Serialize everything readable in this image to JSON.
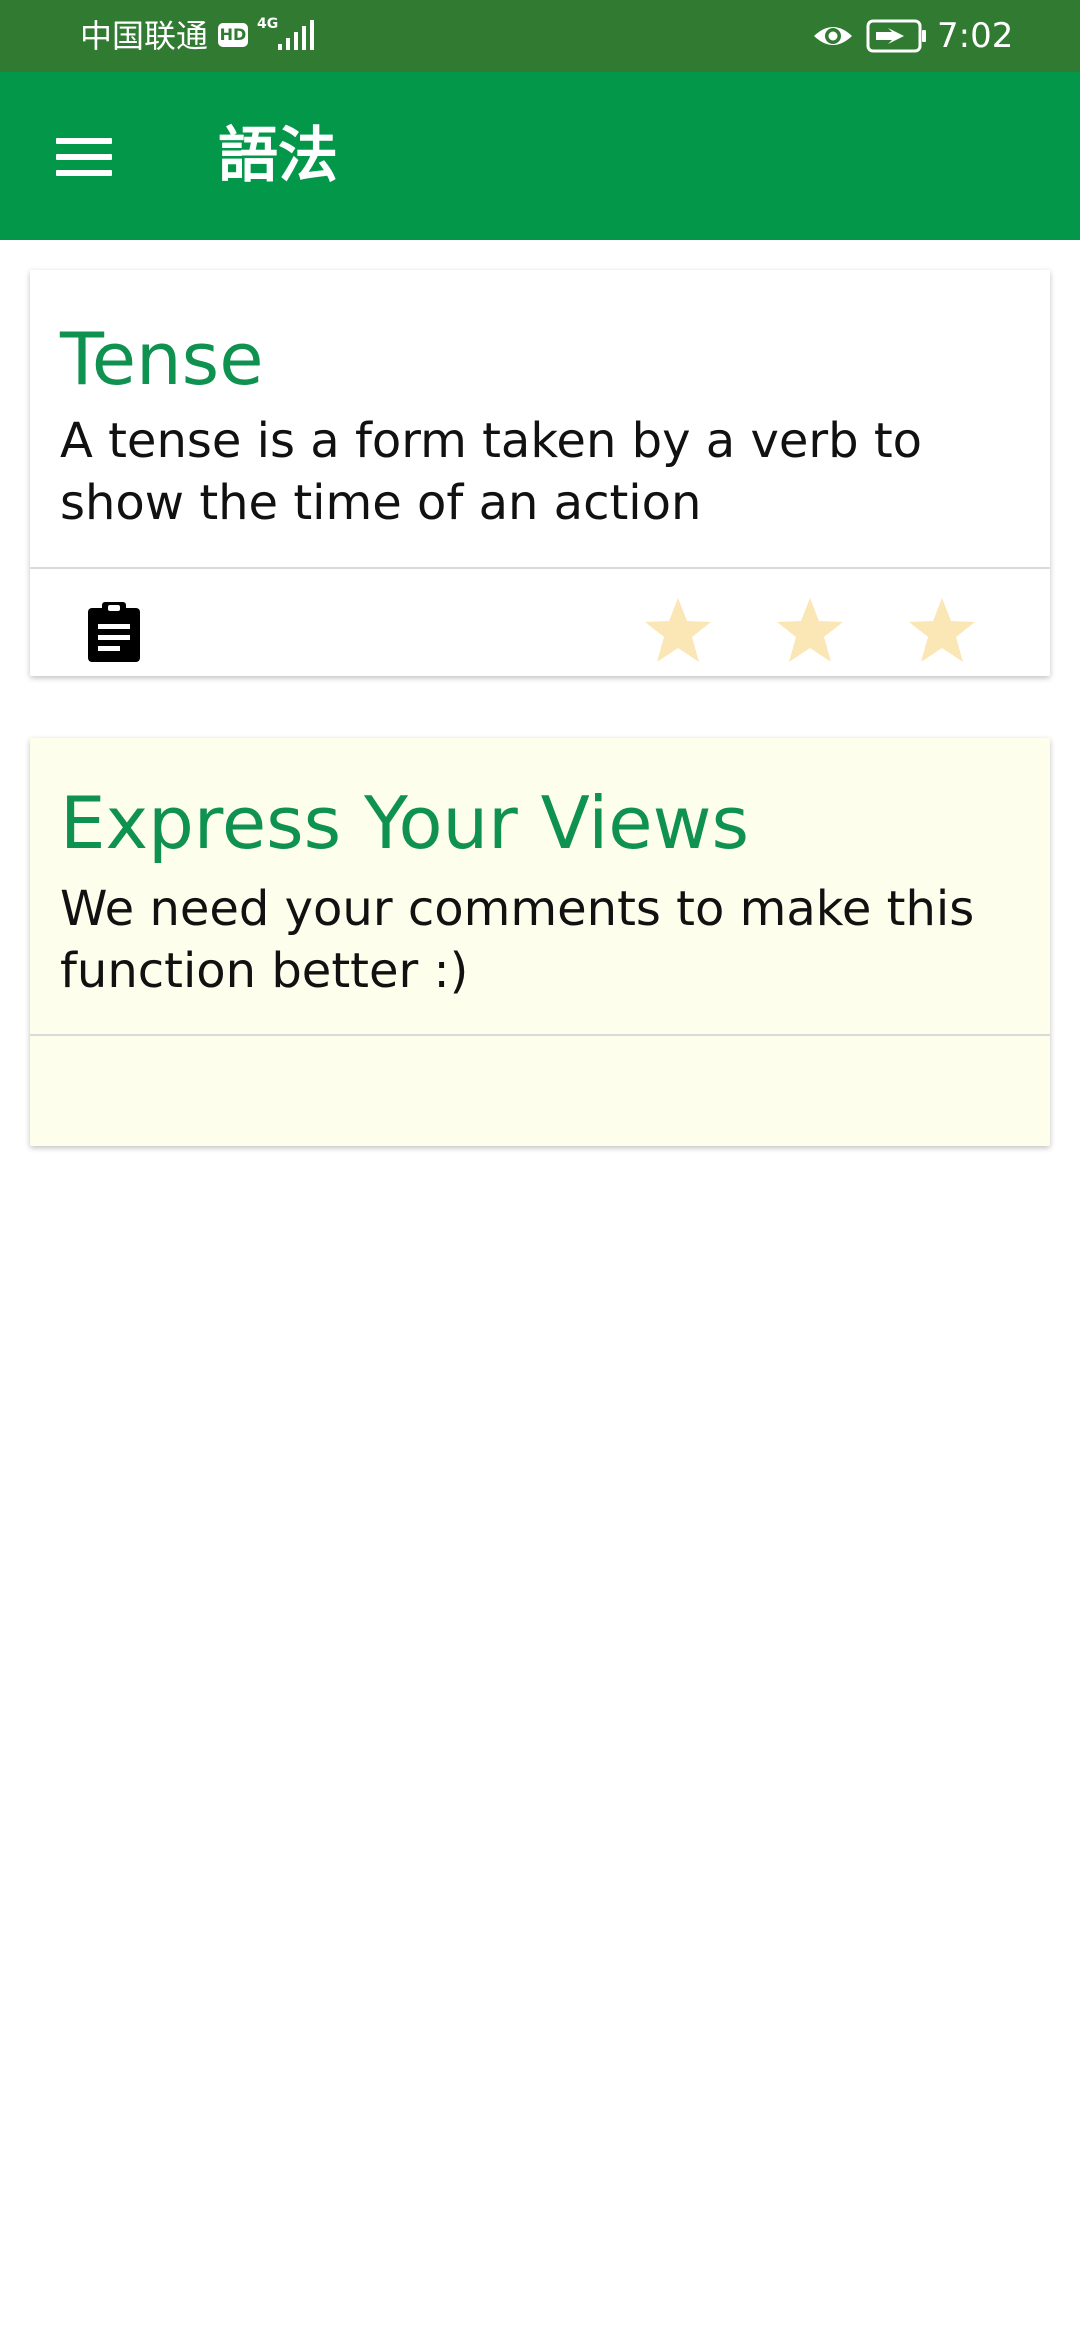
{
  "status_bar": {
    "carrier": "中国联通",
    "hd_badge": "HD",
    "network_type": "4G",
    "time": "7:02",
    "icons": [
      "signal-icon",
      "eye-icon",
      "battery-charging-icon"
    ]
  },
  "app_bar": {
    "title": "語法",
    "menu_icon": "menu-icon",
    "background_color": "#03974a"
  },
  "cards": [
    {
      "title": "Tense",
      "description": "A tense is a form taken by a verb to show the time of an action",
      "action_icon": "clipboard-icon",
      "rating": {
        "max": 3,
        "filled": 0,
        "star_color": "#fbe6b6"
      }
    },
    {
      "title": "Express Your Views",
      "description": "We need your comments to make this function better :)",
      "background_color": "#fefeed"
    }
  ],
  "colors": {
    "status_bar": "#317a31",
    "accent_green": "#0f9150",
    "text_dark": "#111111"
  }
}
